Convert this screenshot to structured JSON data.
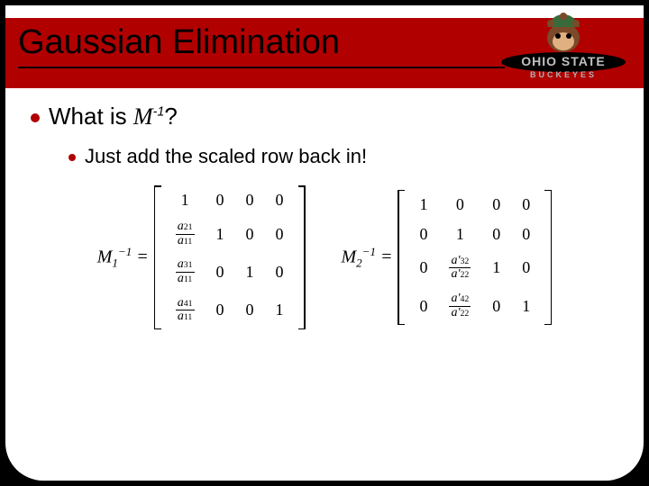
{
  "title": "Gaussian Elimination",
  "logo": {
    "main": "OHIO STATE",
    "sub": "BUCKEYES"
  },
  "bullets": {
    "main_prefix": "What is ",
    "main_var": "M",
    "main_sup": "-1",
    "main_suffix": "?",
    "sub": "Just add the scaled row back in!"
  },
  "matrices": {
    "m1_label_base": "M",
    "m1_label_sub": "1",
    "m1_label_sup": "−1",
    "m2_label_base": "M",
    "m2_label_sub": "2",
    "m2_label_sup": "−1",
    "eq": "=",
    "zero": "0",
    "one": "1",
    "m1": {
      "r2c1": {
        "n_base": "a",
        "n_sub": "21",
        "d_base": "a",
        "d_sub": "11"
      },
      "r3c1": {
        "n_base": "a",
        "n_sub": "31",
        "d_base": "a",
        "d_sub": "11"
      },
      "r4c1": {
        "n_base": "a",
        "n_sub": "41",
        "d_base": "a",
        "d_sub": "11"
      }
    },
    "m2": {
      "r3c2": {
        "n_base": "a'",
        "n_sub": "32",
        "d_base": "a'",
        "d_sub": "22"
      },
      "r4c2": {
        "n_base": "a'",
        "n_sub": "42",
        "d_base": "a'",
        "d_sub": "22"
      }
    }
  }
}
